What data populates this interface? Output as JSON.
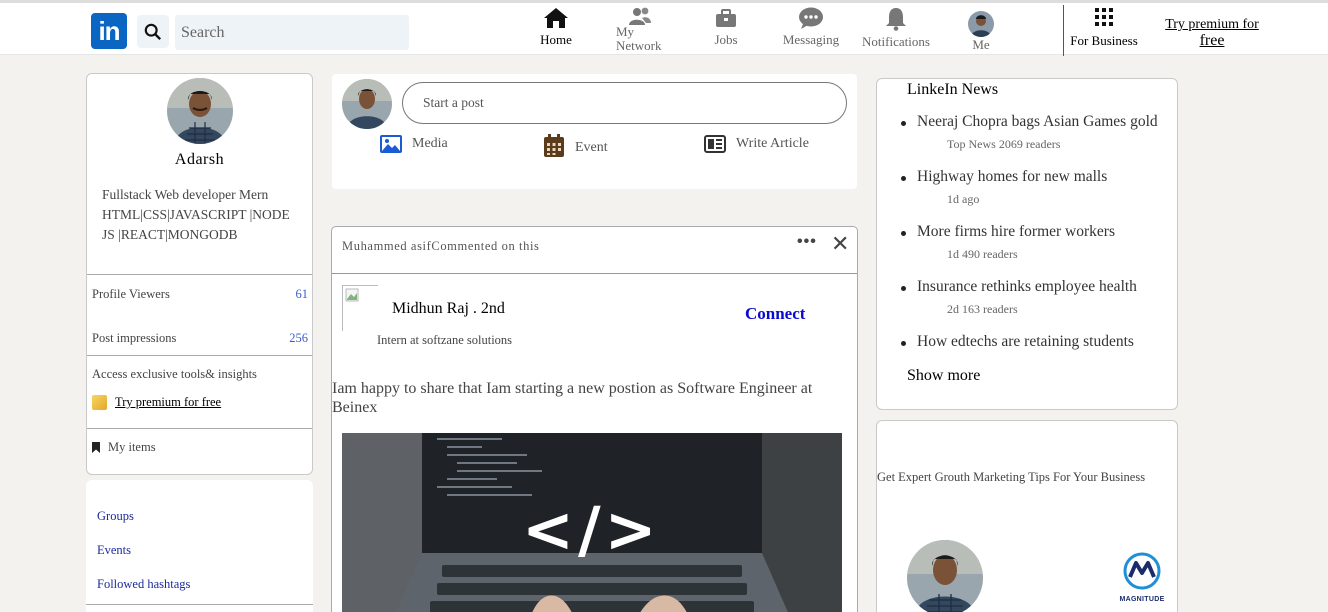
{
  "nav": {
    "logo": "in",
    "search_placeholder": "Search",
    "items": [
      {
        "label": "Home",
        "icon": "home-icon"
      },
      {
        "label": "My\nNetwork",
        "icon": "network-icon"
      },
      {
        "label": "Jobs",
        "icon": "briefcase-icon"
      },
      {
        "label": "Messaging",
        "icon": "messaging-icon"
      },
      {
        "label": "Notifications",
        "icon": "bell-icon"
      },
      {
        "label": "Me",
        "icon": "avatar"
      }
    ],
    "for_business": "For Business",
    "premium_line1": "Try premium for",
    "premium_line2": "free"
  },
  "profile": {
    "name": "Adarsh",
    "bio": "Fullstack Web developer Mern HTML|CSS|JAVASCRIPT |NODE JS |REACT|MONGODB",
    "profile_viewers_label": "Profile Viewers",
    "profile_viewers": "61",
    "post_impressions_label": "Post impressions",
    "post_impressions": "256",
    "access_text": "Access exclusive tools& insights",
    "try_premium": "Try premium for free",
    "my_items": "My items"
  },
  "links": {
    "groups": "Groups",
    "events": "Events",
    "hashtags": "Followed hashtags"
  },
  "composer": {
    "placeholder": "Start a post",
    "media": "Media",
    "event": "Event",
    "article": "Write Article"
  },
  "feed": {
    "header": "Muhammed asifCommented on this",
    "author": "Midhun Raj . 2nd",
    "author_sub": "Intern at softzane solutions",
    "connect": "Connect",
    "text": "Iam happy to share that Iam starting a new postion as Software Engineer at Beinex",
    "image_code": "</>"
  },
  "news": {
    "title": "LinkeIn News",
    "items": [
      {
        "headline": "Neeraj Chopra bags Asian Games gold",
        "meta": "Top News 2069 readers"
      },
      {
        "headline": "Highway homes for new malls",
        "meta": "1d ago"
      },
      {
        "headline": "More firms hire former workers",
        "meta": "1d 490 readers"
      },
      {
        "headline": "Insurance rethinks employee health",
        "meta": "2d 163 readers"
      },
      {
        "headline": "How edtechs are retaining students",
        "meta": ""
      }
    ],
    "show_more": "Show more"
  },
  "ad": {
    "text": "Get Expert Grouth Marketing Tips For Your Business",
    "brand": "MAGNITUDE"
  },
  "colors": {
    "brand": "#0a66c2",
    "link": "#1b2b9c",
    "connect": "#0a0ad0",
    "stat": "#3b5ccc"
  }
}
